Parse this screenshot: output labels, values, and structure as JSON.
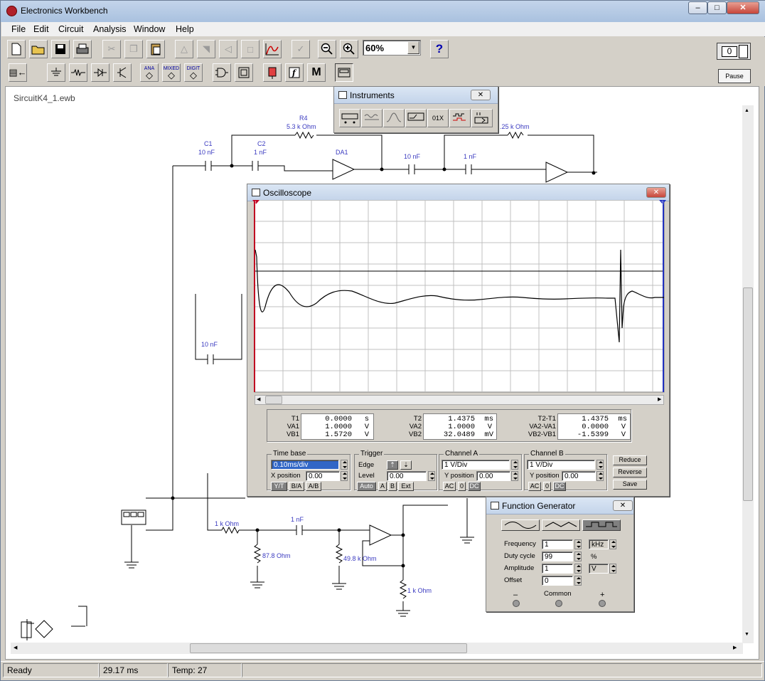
{
  "app": {
    "title": "Electronics Workbench"
  },
  "menu": [
    "File",
    "Edit",
    "Circuit",
    "Analysis",
    "Window",
    "Help"
  ],
  "toolbar": {
    "zoom": "60%",
    "help": "?",
    "pause": "Pause",
    "parts_labels": {
      "analog": "ANA",
      "mixed": "MIXED",
      "digital": "DIGIT",
      "misc": "M"
    }
  },
  "document": {
    "title": "SircuitK4_1.ewb"
  },
  "circuit": {
    "labels": [
      {
        "id": "r4_name",
        "text": "R4"
      },
      {
        "id": "r4_val",
        "text": "5.3 k Ohm"
      },
      {
        "id": "c1_name",
        "text": "C1"
      },
      {
        "id": "c1_val",
        "text": "10 nF"
      },
      {
        "id": "c2_name",
        "text": "C2"
      },
      {
        "id": "c2_val",
        "text": "1 nF"
      },
      {
        "id": "da1",
        "text": "DA1"
      },
      {
        "id": "c3_val",
        "text": "10 nF"
      },
      {
        "id": "c4_val",
        "text": "1 nF"
      },
      {
        "id": "r5_val",
        "text": ".25 k Ohm"
      },
      {
        "id": "c5_val",
        "text": "10 nF"
      },
      {
        "id": "r_in",
        "text": "1 k Ohm"
      },
      {
        "id": "c6_val",
        "text": "1 nF"
      },
      {
        "id": "r_gnd1",
        "text": "87.8   Ohm"
      },
      {
        "id": "r_gnd2",
        "text": "49.8 k Ohm"
      },
      {
        "id": "r_out",
        "text": "1 k Ohm"
      }
    ]
  },
  "instruments": {
    "title": "Instruments"
  },
  "oscilloscope": {
    "title": "Oscilloscope",
    "marker_1": "1",
    "marker_2": "2",
    "readout": {
      "t1": {
        "label": "T1",
        "value": "0.0000",
        "unit": "s"
      },
      "va1": {
        "label": "VA1",
        "value": "1.0000",
        "unit": "V"
      },
      "vb1": {
        "label": "VB1",
        "value": "1.5720",
        "unit": "V"
      },
      "t2": {
        "label": "T2",
        "value": "1.4375",
        "unit": "ms"
      },
      "va2": {
        "label": "VA2",
        "value": "1.0000",
        "unit": "V"
      },
      "vb2": {
        "label": "VB2",
        "value": "32.0489",
        "unit": "mV"
      },
      "dt": {
        "label": "T2-T1",
        "value": "1.4375",
        "unit": "ms"
      },
      "dva": {
        "label": "VA2-VA1",
        "value": "0.0000",
        "unit": "V"
      },
      "dvb": {
        "label": "VB2-VB1",
        "value": "-1.5399",
        "unit": "V"
      }
    },
    "timebase": {
      "title": "Time base",
      "value": "0.10ms/div",
      "xpos_label": "X position",
      "xpos": "0.00",
      "modes": [
        "Y/T",
        "B/A",
        "A/B"
      ]
    },
    "trigger": {
      "title": "Trigger",
      "edge_label": "Edge",
      "level_label": "Level",
      "level": "0.00",
      "sources": [
        "Auto",
        "A",
        "B",
        "Ext"
      ]
    },
    "channel_a": {
      "title": "Channel A",
      "scale": "1  V/Div",
      "ypos_label": "Y position",
      "ypos": "0.00",
      "coupling": [
        "AC",
        "0",
        "DC"
      ]
    },
    "channel_b": {
      "title": "Channel B",
      "scale": "1  V/Div",
      "ypos_label": "Y position",
      "ypos": "0.00",
      "coupling": [
        "AC",
        "0",
        "DC"
      ]
    },
    "buttons": {
      "reduce": "Reduce",
      "reverse": "Reverse",
      "save": "Save"
    }
  },
  "function_generator": {
    "title": "Function Generator",
    "frequency": {
      "label": "Frequency",
      "value": "1",
      "unit": "kHz"
    },
    "duty": {
      "label": "Duty cycle",
      "value": "99",
      "unit": "%"
    },
    "amplitude": {
      "label": "Amplitude",
      "value": "1",
      "unit": "V"
    },
    "offset": {
      "label": "Offset",
      "value": "0"
    },
    "terminals": {
      "minus": "–",
      "common": "Common",
      "plus": "+"
    }
  },
  "status": {
    "state": "Ready",
    "time": "29.17 ms",
    "temp": "Temp:  27"
  }
}
